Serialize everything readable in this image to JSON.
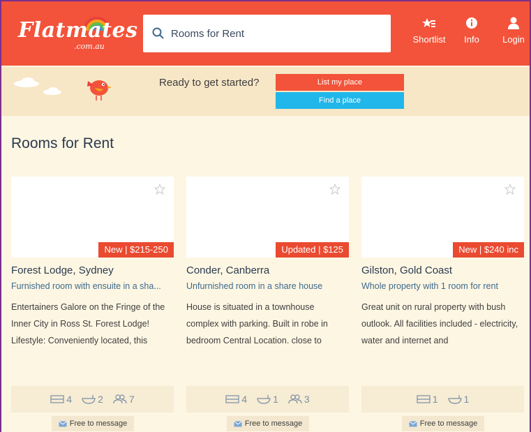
{
  "header": {
    "logo_text": "Flatmates",
    "logo_sub": ".com.au",
    "search_text": "Rooms for Rent",
    "nav": [
      {
        "label": "Shortlist",
        "icon": "shortlist-star-icon"
      },
      {
        "label": "Info",
        "icon": "info-icon"
      },
      {
        "label": "Login",
        "icon": "user-icon"
      }
    ]
  },
  "banner": {
    "question": "Ready to get started?",
    "list_button": "List my place",
    "find_button": "Find a place"
  },
  "main": {
    "title": "Rooms for Rent",
    "cards": [
      {
        "price": "New | $215-250",
        "location": "Forest Lodge, Sydney",
        "type": "Furnished room with ensuite in a sha...",
        "description": "Entertainers Galore on the Fringe of the Inner City in Ross St. Forest Lodge! Lifestyle: Conveniently located, this",
        "bedrooms": "4",
        "bathrooms": "2",
        "flatmates": "7",
        "message": "Free to message"
      },
      {
        "price": "Updated | $125",
        "location": "Conder, Canberra",
        "type": "Unfurnished room in a share house",
        "description": "House is situated in a townhouse complex with parking. Built in robe in bedroom Central Location. close to",
        "bedrooms": "4",
        "bathrooms": "1",
        "flatmates": "3",
        "message": "Free to message"
      },
      {
        "price": "New | $240 inc",
        "location": "Gilston, Gold Coast",
        "type": "Whole property with 1 room for rent",
        "description": "Great unit on rural property with bush outlook. All facilities included - electricity, water and internet and",
        "bedrooms": "1",
        "bathrooms": "1",
        "message": "Free to message"
      }
    ]
  },
  "colors": {
    "brand": "#f2533a",
    "accent_blue": "#21b7ea",
    "background": "#fdf6e3",
    "banner": "#f7e7c6"
  }
}
